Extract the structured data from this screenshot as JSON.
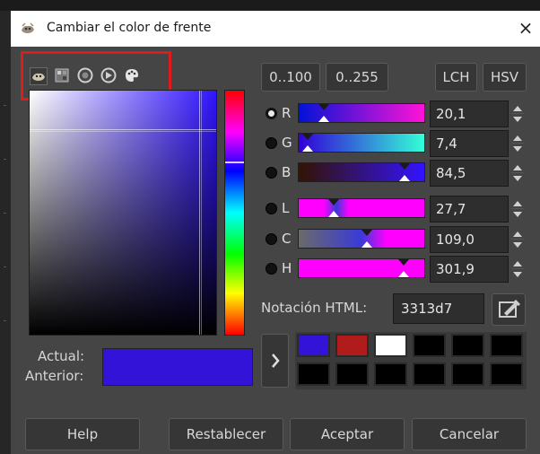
{
  "window": {
    "title": "Cambiar el color de frente",
    "close_symbol": "×"
  },
  "selector_tabs": [
    {
      "name": "gimp-selector-icon",
      "active": true
    },
    {
      "name": "cmyk-selector-icon",
      "active": false
    },
    {
      "name": "triangle-wheel-icon",
      "active": false
    },
    {
      "name": "wheel-icon",
      "active": false
    },
    {
      "name": "watercolor-palette-icon",
      "active": false
    }
  ],
  "range_buttons": {
    "percent": "0..100",
    "byte": "0..255"
  },
  "model_buttons": {
    "lch": "LCH",
    "hsv": "HSV"
  },
  "channels": [
    {
      "key": "r",
      "label": "R",
      "value": "20,1",
      "fraction": 0.201,
      "selected": true
    },
    {
      "key": "g",
      "label": "G",
      "value": "7,4",
      "fraction": 0.074,
      "selected": false
    },
    {
      "key": "b",
      "label": "B",
      "value": "84,5",
      "fraction": 0.845,
      "selected": false
    },
    {
      "key": "l",
      "label": "L",
      "value": "27,7",
      "fraction": 0.277,
      "selected": false
    },
    {
      "key": "c",
      "label": "C",
      "value": "109,0",
      "fraction": 0.545,
      "selected": false
    },
    {
      "key": "h",
      "label": "H",
      "value": "301,9",
      "fraction": 0.839,
      "selected": false
    }
  ],
  "html_notation": {
    "label": "Notación HTML:",
    "value": "3313d7"
  },
  "swatch": {
    "actual_label": "Actual:",
    "previous_label": "Anterior:",
    "color": "#3313d7"
  },
  "history_colors": [
    "#3313d7",
    "#b01b1b",
    "#ffffff",
    "#000000",
    "#000000",
    "#000000",
    "#000000",
    "#000000",
    "#000000",
    "#000000",
    "#000000",
    "#000000"
  ],
  "buttons": {
    "help": "Help",
    "reset": "Restablecer",
    "ok": "Aceptar",
    "cancel": "Cancelar"
  },
  "colors": {
    "current": "#3313d7",
    "accent_box": "#e01b1b"
  }
}
